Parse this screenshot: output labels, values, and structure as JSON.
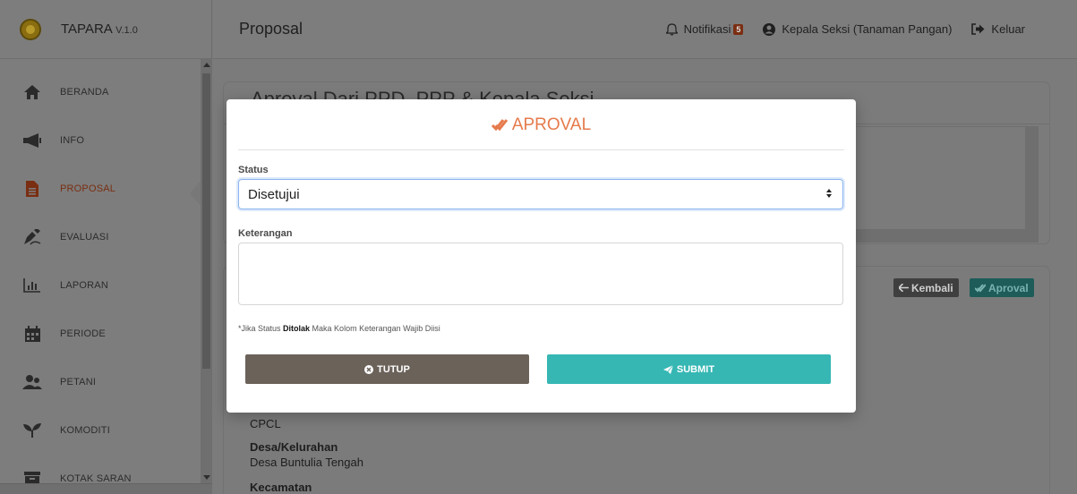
{
  "brand": {
    "name": "TAPARA",
    "version": "V.1.0"
  },
  "sidebar": {
    "items": [
      {
        "label": "BERANDA",
        "icon": "home-icon"
      },
      {
        "label": "INFO",
        "icon": "megaphone-icon"
      },
      {
        "label": "PROPOSAL",
        "icon": "document-icon",
        "active": true
      },
      {
        "label": "EVALUASI",
        "icon": "signature-icon"
      },
      {
        "label": "LAPORAN",
        "icon": "bar-chart-icon"
      },
      {
        "label": "PERIODE",
        "icon": "calendar-icon"
      },
      {
        "label": "PETANI",
        "icon": "users-icon"
      },
      {
        "label": "KOMODITI",
        "icon": "seedling-icon"
      },
      {
        "label": "KOTAK SARAN",
        "icon": "inbox-icon"
      }
    ]
  },
  "header": {
    "title": "Proposal",
    "notification_label": "Notifikasi",
    "notification_count": "5",
    "user_label": "Kepala Seksi (Tanaman Pangan)",
    "logout_label": "Keluar"
  },
  "background": {
    "card_title": "Aproval Dari PPD, PPP & Kepala Seksi",
    "back_button": "Kembali",
    "aproval_button": "Aproval",
    "detail_cpcl": "CPCL",
    "detail_desa_label": "Desa/Kelurahan",
    "detail_desa_value": "Desa Buntulia Tengah",
    "detail_kecamatan_label": "Kecamatan"
  },
  "modal": {
    "title": "APROVAL",
    "status_label": "Status",
    "status_value": "Disetujui",
    "keterangan_label": "Keterangan",
    "keterangan_value": "",
    "note_prefix": "*Jika Status ",
    "note_bold": "Ditolak",
    "note_suffix": " Maka Kolom Keterangan Wajib Diisi",
    "close_button": "TUTUP",
    "submit_button": "SUBMIT"
  },
  "colors": {
    "accent_orange": "#e67a4b",
    "submit_teal": "#36b7b4",
    "close_brown": "#6b625a",
    "active_nav": "#7a2e12"
  }
}
